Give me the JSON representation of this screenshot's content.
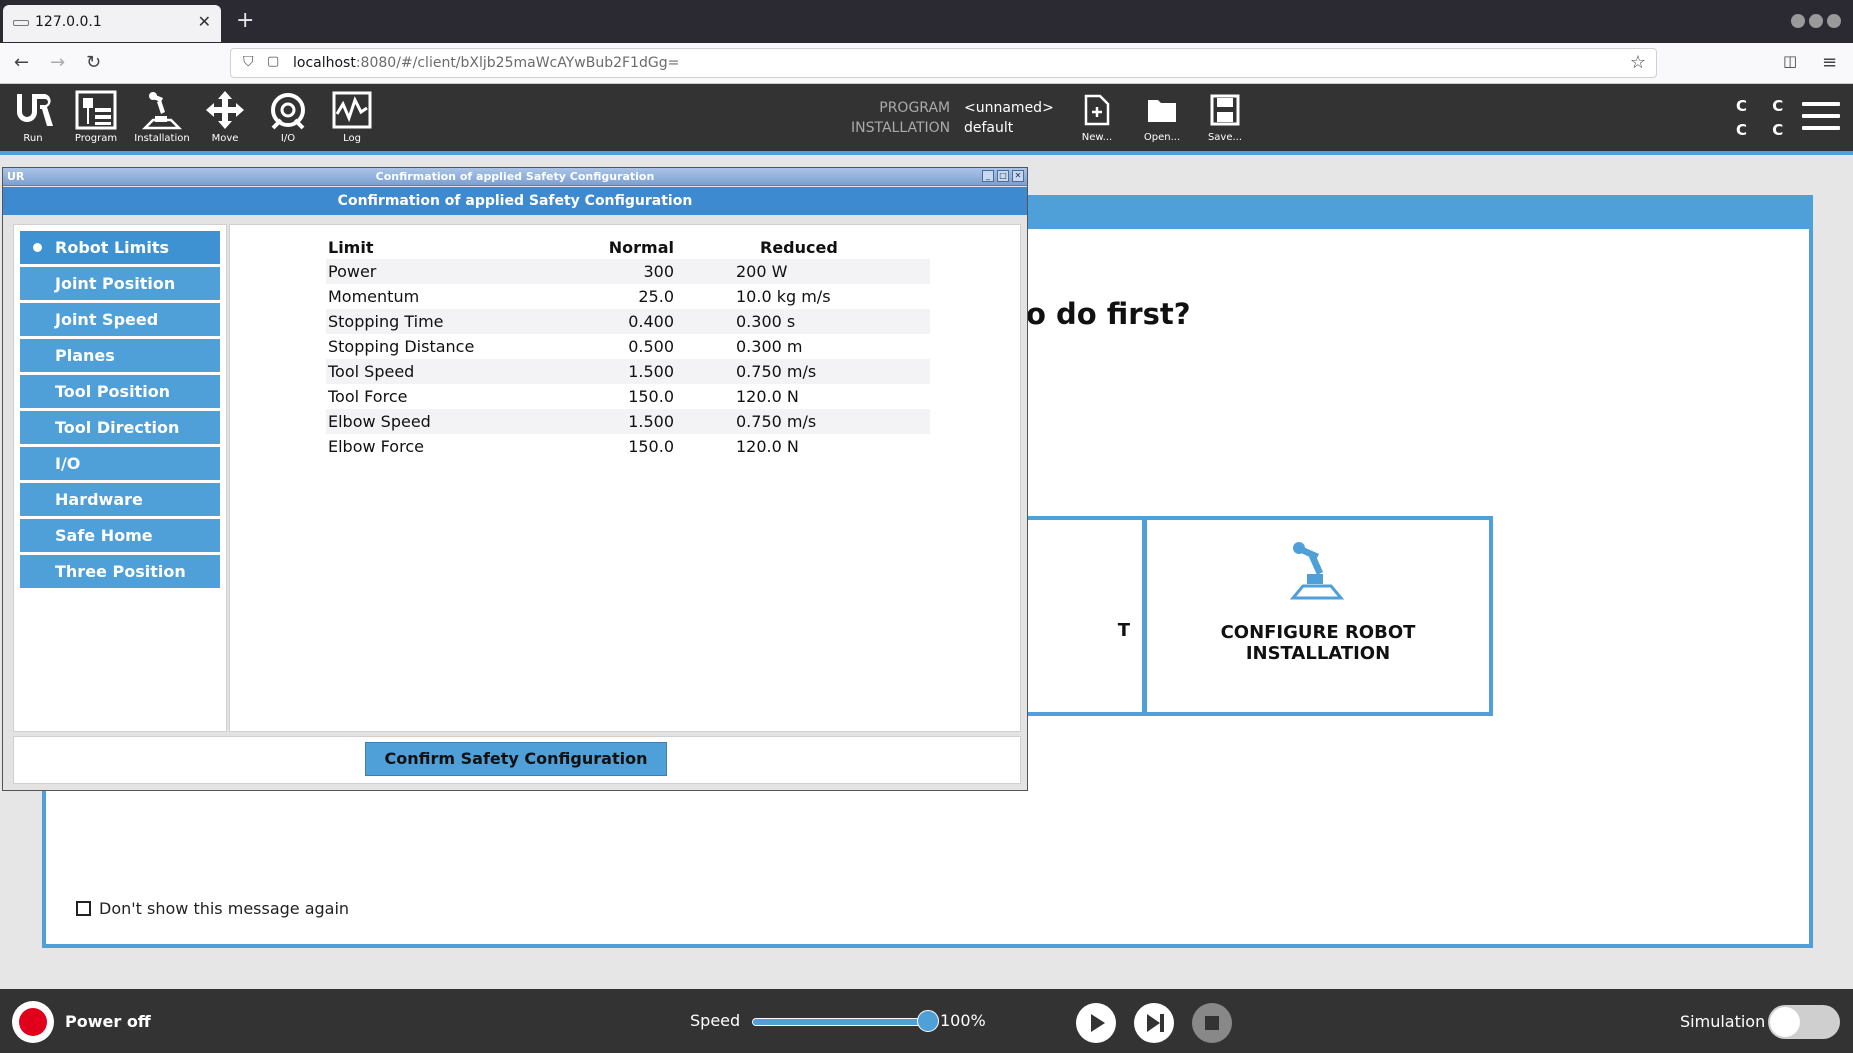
{
  "browser": {
    "tab_title": "127.0.0.1",
    "url_host": "localhost",
    "url_rest": ":8080/#/client/bXljb25maWcAYwBub2F1dGg="
  },
  "header": {
    "nav": [
      {
        "label": "Run",
        "icon": "ur-logo-icon"
      },
      {
        "label": "Program",
        "icon": "program-icon"
      },
      {
        "label": "Installation",
        "icon": "installation-icon"
      },
      {
        "label": "Move",
        "icon": "move-icon"
      },
      {
        "label": "I/O",
        "icon": "io-icon"
      },
      {
        "label": "Log",
        "icon": "log-icon"
      }
    ],
    "program_label": "PROGRAM",
    "program_value": "<unnamed>",
    "installation_label": "INSTALLATION",
    "installation_value": "default",
    "file_tools": [
      {
        "label": "New...",
        "icon": "new-file-icon"
      },
      {
        "label": "Open...",
        "icon": "open-folder-icon"
      },
      {
        "label": "Save...",
        "icon": "save-icon"
      }
    ],
    "cc_text": "C C\nC C"
  },
  "welcome": {
    "question_fragment": "o do first?",
    "left_card_fragment": "T",
    "right_card_label": "CONFIGURE ROBOT INSTALLATION",
    "dont_show_label": "Don't show this message again"
  },
  "dialog": {
    "window_title": "Confirmation of applied Safety Configuration",
    "header": "Confirmation of applied Safety Configuration",
    "sidebar": [
      {
        "label": "Robot Limits",
        "active": true
      },
      {
        "label": "Joint Position",
        "active": false
      },
      {
        "label": "Joint Speed",
        "active": false
      },
      {
        "label": "Planes",
        "active": false
      },
      {
        "label": "Tool Position",
        "active": false
      },
      {
        "label": "Tool Direction",
        "active": false
      },
      {
        "label": "I/O",
        "active": false
      },
      {
        "label": "Hardware",
        "active": false
      },
      {
        "label": "Safe Home",
        "active": false
      },
      {
        "label": "Three Position",
        "active": false
      }
    ],
    "table": {
      "columns": [
        "Limit",
        "Normal",
        "Reduced"
      ],
      "rows": [
        {
          "limit": "Power",
          "normal": "300",
          "reduced": "200 W"
        },
        {
          "limit": "Momentum",
          "normal": "25.0",
          "reduced": "10.0 kg m/s"
        },
        {
          "limit": "Stopping Time",
          "normal": "0.400",
          "reduced": "0.300 s"
        },
        {
          "limit": "Stopping Distance",
          "normal": "0.500",
          "reduced": "0.300 m"
        },
        {
          "limit": "Tool Speed",
          "normal": "1.500",
          "reduced": "0.750 m/s"
        },
        {
          "limit": "Tool Force",
          "normal": "150.0",
          "reduced": "120.0 N"
        },
        {
          "limit": "Elbow Speed",
          "normal": "1.500",
          "reduced": "0.750 m/s"
        },
        {
          "limit": "Elbow Force",
          "normal": "150.0",
          "reduced": "120.0 N"
        }
      ]
    },
    "confirm_label": "Confirm Safety Configuration"
  },
  "footer": {
    "power_label": "Power off",
    "speed_label": "Speed",
    "speed_value": "100%",
    "speed_fraction": 1.0,
    "simulation_label": "Simulation",
    "simulation_on": false
  },
  "colors": {
    "accent": "#4f9fd8",
    "header_bg": "#333333",
    "power_red": "#e0001b"
  }
}
